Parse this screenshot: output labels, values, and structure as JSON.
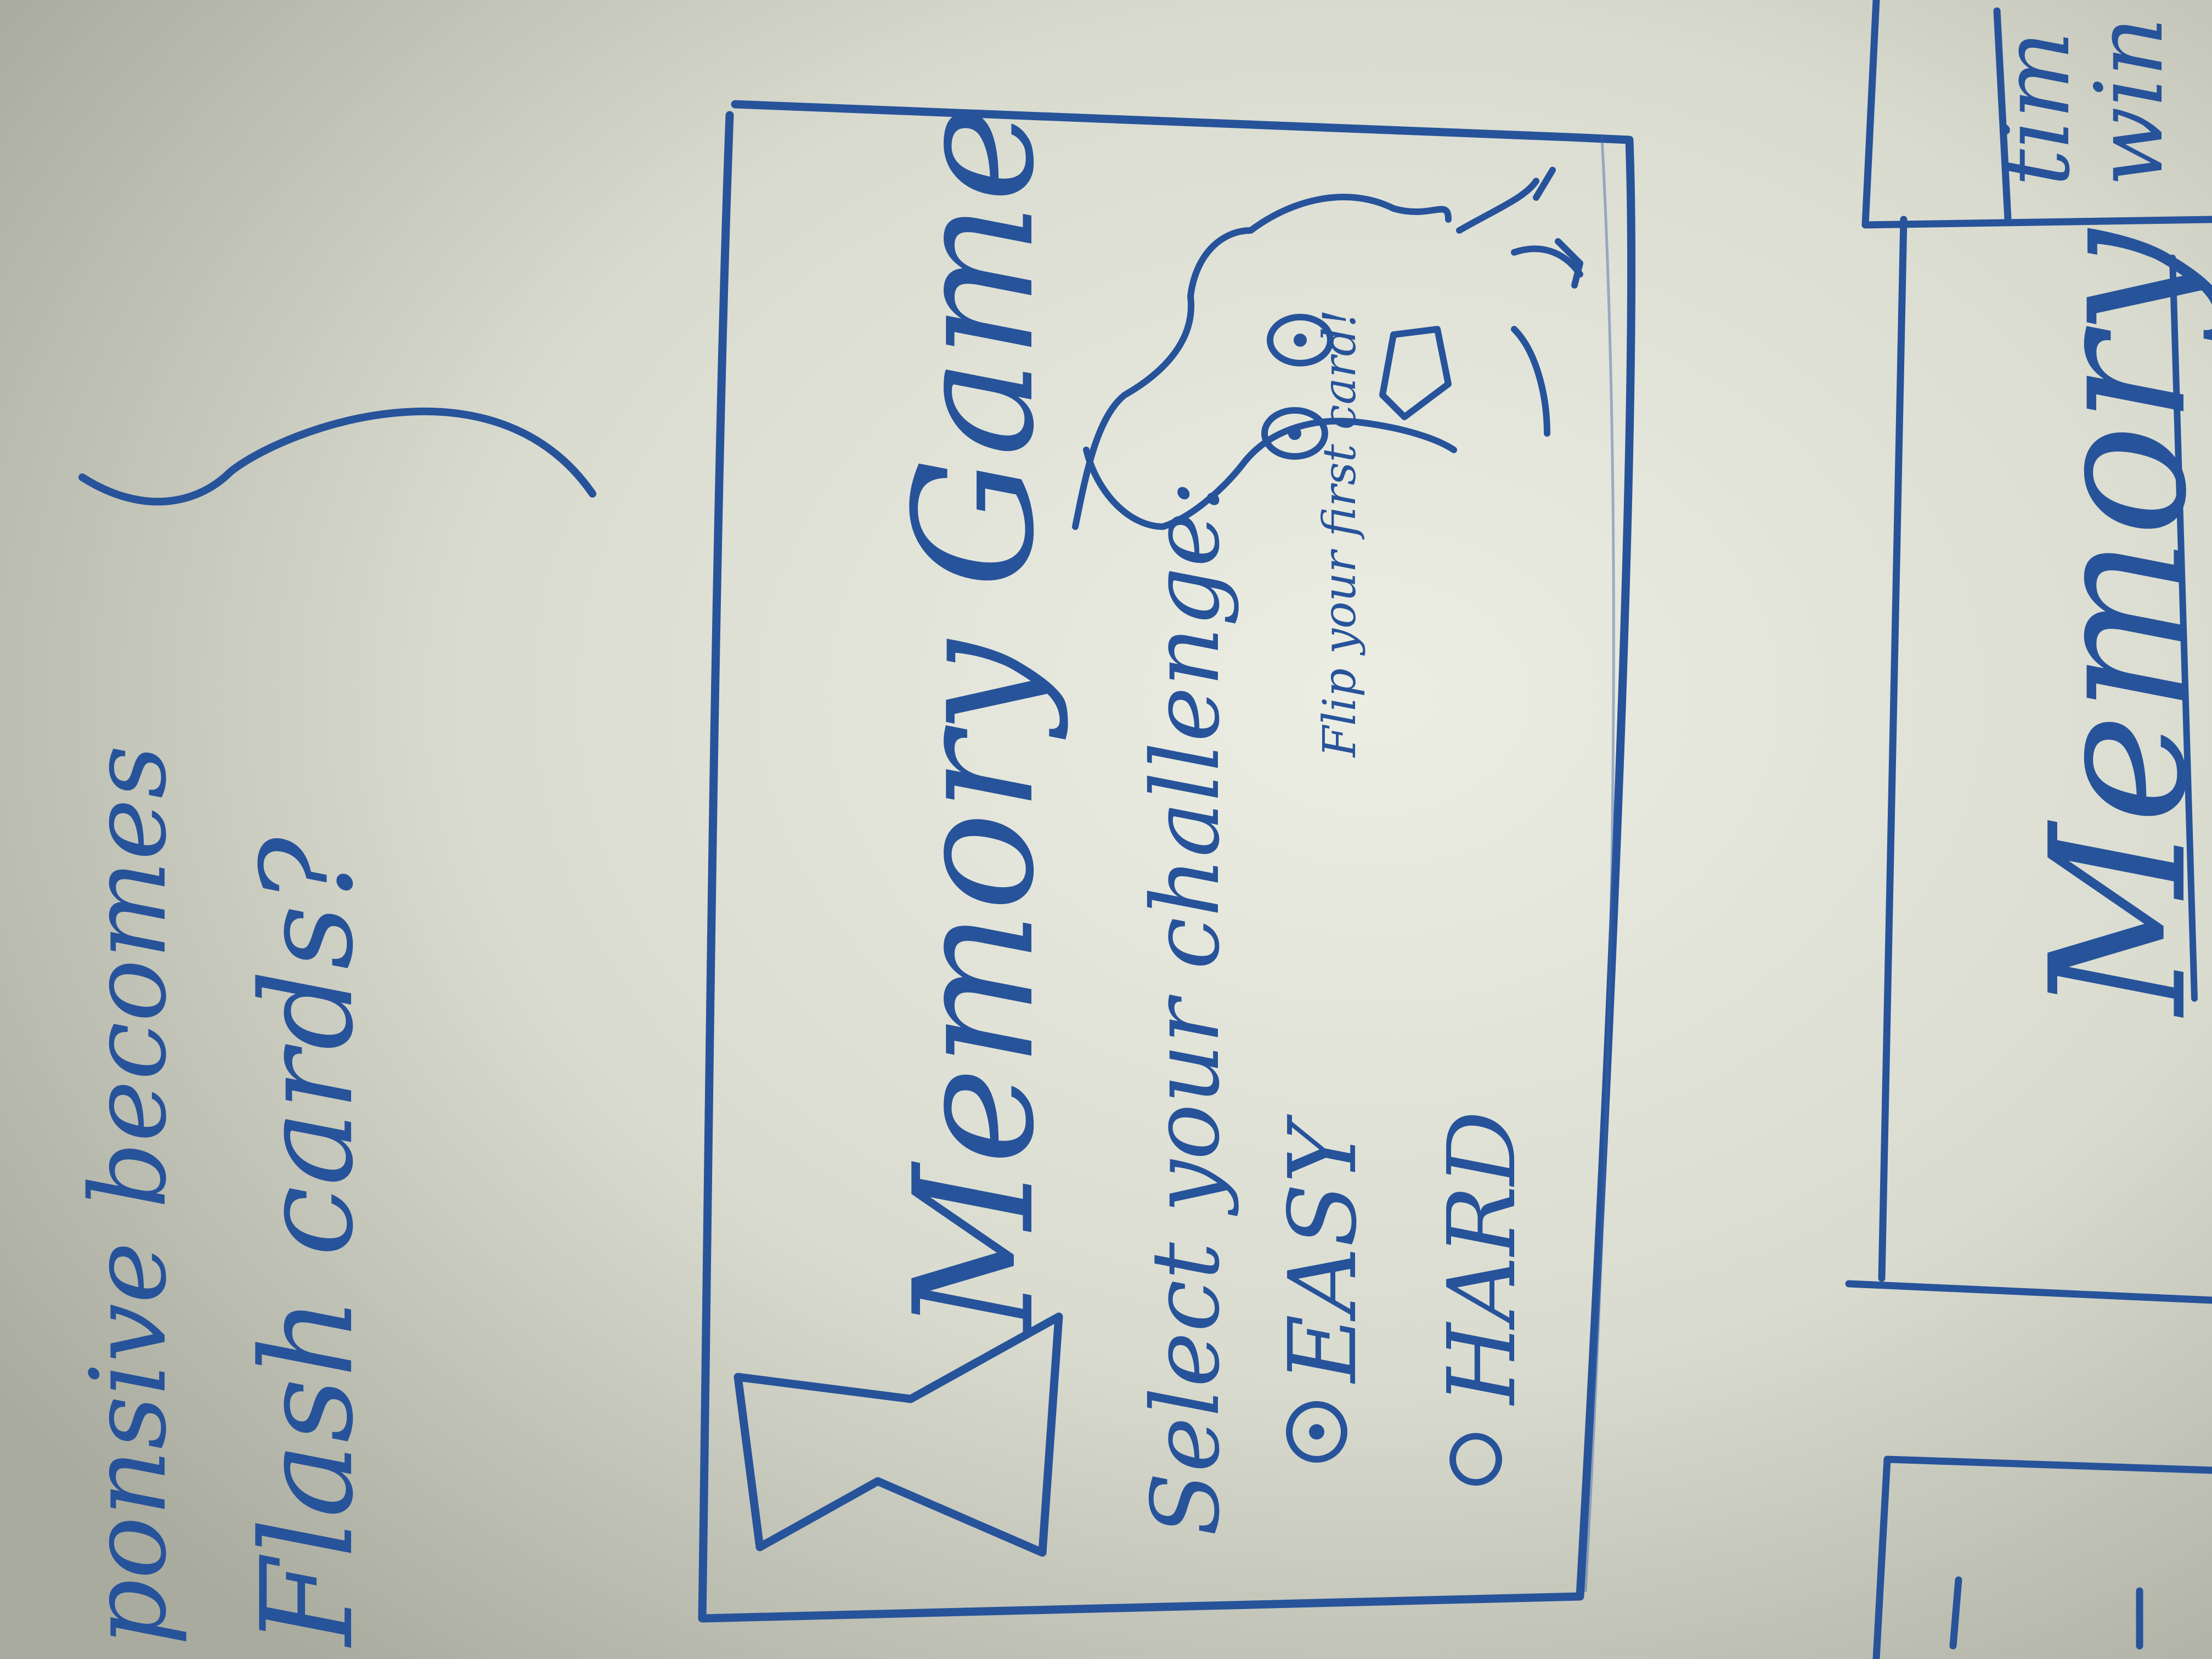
{
  "whiteboard": {
    "left_notes": {
      "line1": "ponsive ",
      "line1_word2": "becomes",
      "line2": "Flash cards?"
    },
    "sketch": {
      "title": "Memory Game",
      "prompt": "Select your challenge:",
      "options": [
        "EASY",
        "HARD"
      ],
      "mascot_note": "Flip your first card!"
    },
    "right_sketch": {
      "title_fragment": "Memory",
      "corner_text_1": "tim",
      "corner_text_2": "win"
    }
  },
  "colors": {
    "board": "#c9cbbf",
    "marker": "#27539a"
  }
}
